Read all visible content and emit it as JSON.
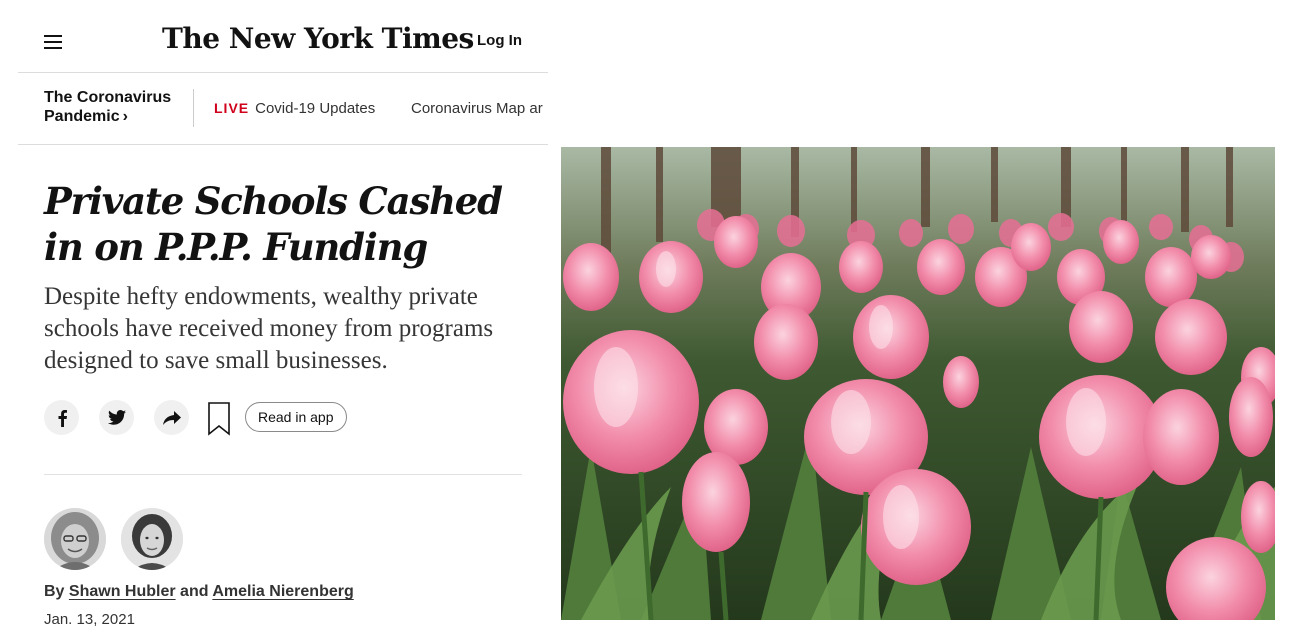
{
  "header": {
    "logo_text": "The New York Times",
    "login_label": "Log In"
  },
  "subnav": {
    "section_line1": "The Coronavirus",
    "section_line2": "Pandemic",
    "section_chevron": "›",
    "live_tag": "LIVE",
    "live_label": "Covid-19 Updates",
    "map_label": "Coronavirus Map ar"
  },
  "article": {
    "headline": "Private Schools Cashed in on P.P.P. Funding",
    "summary": "Despite hefty endowments, wealthy private schools have received money from programs designed to save small businesses.",
    "share_icons": [
      "facebook-icon",
      "twitter-icon",
      "share-arrow-icon",
      "bookmark-icon"
    ],
    "read_in_app_label": "Read in app",
    "byline_prefix": "By",
    "author_1": "Shawn Hubler",
    "byline_and": "and",
    "author_2": "Amelia Nierenberg",
    "date": "Jan. 13, 2021"
  },
  "photo": {
    "subject": "pink tulip field in a forest"
  },
  "colors": {
    "text": "#121212",
    "live_red": "#d0021b",
    "tulip_pink": "#f08aa6",
    "leaf_green": "#4f7a3a"
  }
}
